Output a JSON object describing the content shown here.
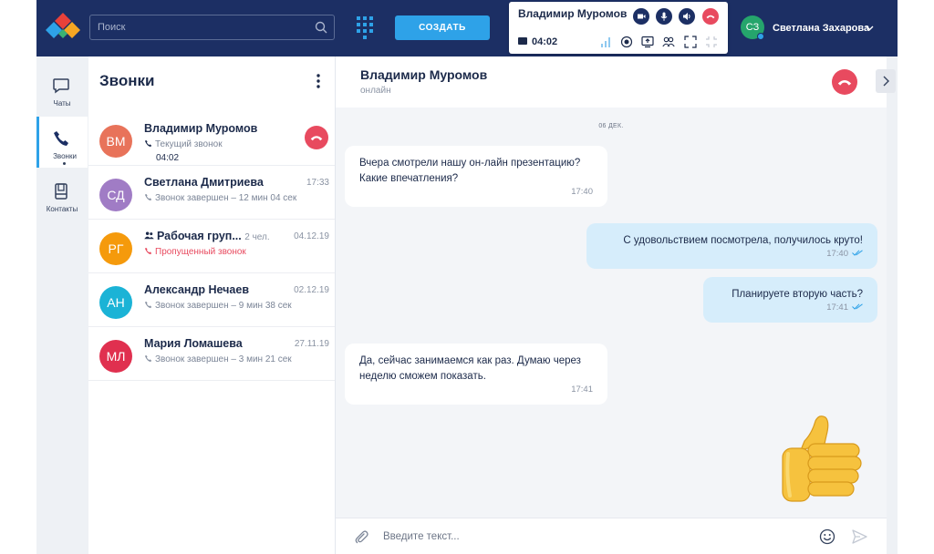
{
  "topbar": {
    "search_placeholder": "Поиск",
    "create_label": "СОЗДАТЬ",
    "call_widget": {
      "name": "Владимир Муромов",
      "timer": "04:02"
    },
    "user": {
      "initials": "СЗ",
      "name": "Светлана Захарова"
    }
  },
  "nav": {
    "items": [
      {
        "label": "Чаты"
      },
      {
        "label": "Звонки"
      },
      {
        "label": "Контакты"
      }
    ]
  },
  "calls": {
    "title": "Звонки",
    "items": [
      {
        "initials": "ВМ",
        "name": "Владимир Муромов",
        "status": "Текущий звонок",
        "duration": "04:02",
        "date": "",
        "color": "#e8735a"
      },
      {
        "initials": "СД",
        "name": "Светлана Дмитриева",
        "status": "Звонок завершен – 12 мин 04 сек",
        "date": "17:33",
        "color": "#a07cc5"
      },
      {
        "initials": "РГ",
        "name": "Рабочая груп...",
        "members": "2 чел.",
        "status": "Пропущенный звонок",
        "date": "04.12.19",
        "color": "#f59a0c"
      },
      {
        "initials": "АН",
        "name": "Александр Нечаев",
        "status": "Звонок завершен – 9 мин 38 сек",
        "date": "02.12.19",
        "color": "#1bb3d6"
      },
      {
        "initials": "МЛ",
        "name": "Мария Ломашева",
        "status": "Звонок завершен – 3 мин 21 сек",
        "date": "27.11.19",
        "color": "#e0304f"
      }
    ]
  },
  "chat": {
    "name": "Владимир Муромов",
    "status": "онлайн",
    "day": "06 ДЕК.",
    "messages": [
      {
        "dir": "in",
        "text_1": "Вчера смотрели нашу он-лайн презентацию?",
        "text_2": "Какие впечатления?",
        "time": "17:40"
      },
      {
        "dir": "out",
        "text_1": "С удовольствием посмотрела, получилось круто!",
        "time": "17:40"
      },
      {
        "dir": "out",
        "text_1": "Планируете вторую часть?",
        "time": "17:41"
      },
      {
        "dir": "in",
        "text_1": "Да, сейчас занимаемся как раз. Думаю через",
        "text_2": "неделю сможем показать.",
        "time": "17:41"
      }
    ],
    "input_placeholder": "Введите текст..."
  },
  "colors": {
    "navy": "#1c2f64",
    "accent": "#2ea2e8",
    "hangup": "#e84a5f",
    "outgoing_bubble": "#d6edfb"
  }
}
